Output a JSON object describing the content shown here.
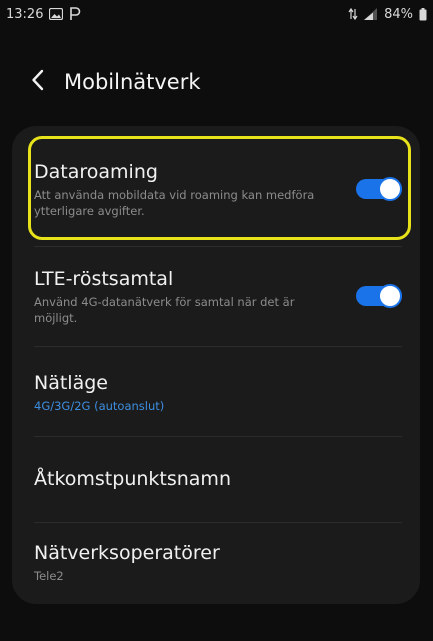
{
  "status_bar": {
    "time": "13:26",
    "left_icons": [
      "gallery-icon",
      "p-notification-icon"
    ],
    "right_icons": [
      "data-arrows-icon",
      "signal-icon",
      "battery-icon"
    ],
    "battery_percent": "84%"
  },
  "header": {
    "title": "Mobilnätverk",
    "back_icon": "chevron-left-icon"
  },
  "settings": [
    {
      "title": "Dataroaming",
      "summary": "Att använda mobildata vid roaming kan medföra ytterligare avgifter.",
      "toggle": true,
      "highlighted": true
    },
    {
      "title": "LTE-röstsamtal",
      "summary": "Använd 4G-datanätverk för samtal när det är möjligt.",
      "toggle": true
    },
    {
      "title": "Nätläge",
      "summary": "4G/3G/2G (autoanslut)",
      "summary_color": "#3d8ee0"
    },
    {
      "title": "Åtkomstpunktsnamn"
    },
    {
      "title": "Nätverksoperatörer",
      "summary": "Tele2"
    }
  ],
  "colors": {
    "accent": "#1a73e8",
    "highlight_border": "#e7e21a",
    "background": "#0d0d0d",
    "card": "#1b1b1b"
  }
}
